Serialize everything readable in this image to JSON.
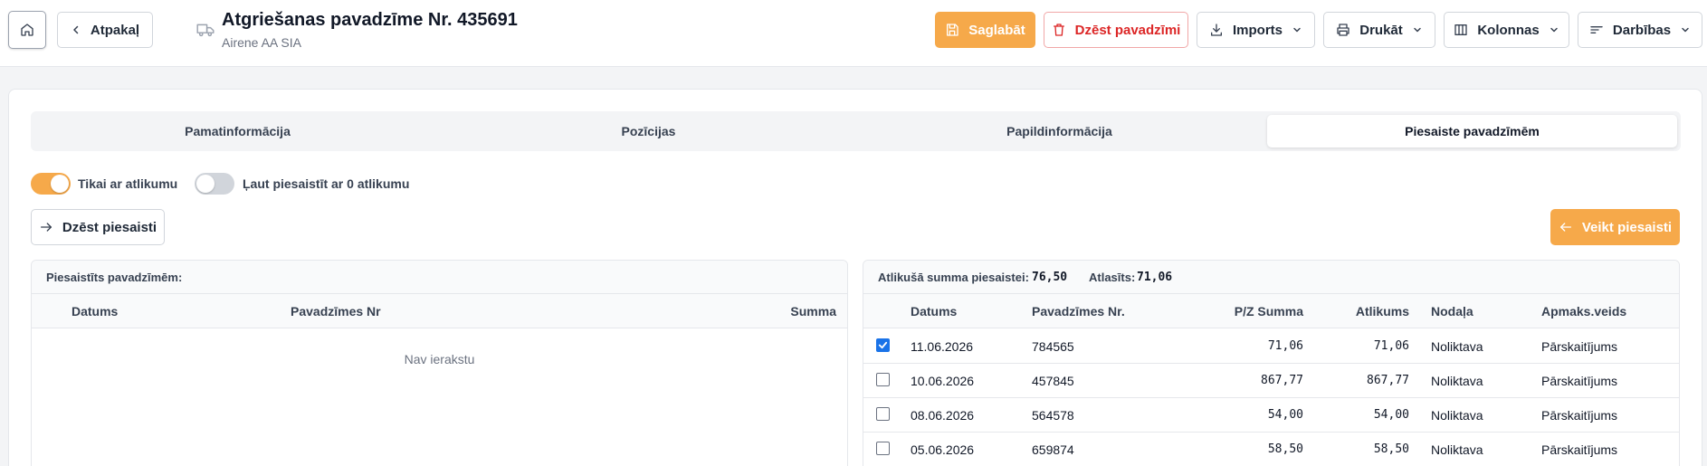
{
  "header": {
    "back_label": "Atpakaļ",
    "title": "Atgriešanas pavadzīme Nr. 435691",
    "subtitle": "Airene AA SIA",
    "save_label": "Saglabāt",
    "delete_label": "Dzēst pavadzīmi",
    "imports_label": "Imports",
    "print_label": "Drukāt",
    "columns_label": "Kolonnas",
    "actions_label": "Darbības"
  },
  "tabs": [
    {
      "label": "Pamatinformācija",
      "active": false
    },
    {
      "label": "Pozīcijas",
      "active": false
    },
    {
      "label": "Papildinformācija",
      "active": false
    },
    {
      "label": "Piesaiste pavadzīmēm",
      "active": true
    }
  ],
  "filters": {
    "only_with_balance": {
      "label": "Tikai ar atlikumu",
      "on": true
    },
    "allow_zero_balance": {
      "label": "Ļaut piesaistīt ar 0 atlikumu",
      "on": false
    }
  },
  "actions": {
    "unlink_label": "Dzēst piesaisti",
    "link_label": "Veikt piesaisti"
  },
  "linked_panel": {
    "title": "Piesaistīts pavadzīmēm:",
    "columns": [
      "Datums",
      "Pavadzīmes Nr",
      "Summa"
    ],
    "empty_text": "Nav ierakstu"
  },
  "available_panel": {
    "remaining_label": "Atlikušā summa piesaistei:",
    "remaining_value": "76,50",
    "selected_label": "Atlasīts:",
    "selected_value": "71,06",
    "columns": [
      "Datums",
      "Pavadzīmes Nr.",
      "P/Z Summa",
      "Atlikums",
      "Nodaļa",
      "Apmaks.veids"
    ],
    "rows": [
      {
        "checked": true,
        "date": "11.06.2026",
        "number": "784565",
        "amount": "71,06",
        "balance": "71,06",
        "department": "Noliktava",
        "payment": "Pārskaitījums"
      },
      {
        "checked": false,
        "date": "10.06.2026",
        "number": "457845",
        "amount": "867,77",
        "balance": "867,77",
        "department": "Noliktava",
        "payment": "Pārskaitījums"
      },
      {
        "checked": false,
        "date": "08.06.2026",
        "number": "564578",
        "amount": "54,00",
        "balance": "54,00",
        "department": "Noliktava",
        "payment": "Pārskaitījums"
      },
      {
        "checked": false,
        "date": "05.06.2026",
        "number": "659874",
        "amount": "58,50",
        "balance": "58,50",
        "department": "Noliktava",
        "payment": "Pārskaitījums"
      }
    ]
  },
  "colors": {
    "accent": "#f6a94a",
    "danger": "#dc2626",
    "checkbox": "#1a73e8"
  }
}
